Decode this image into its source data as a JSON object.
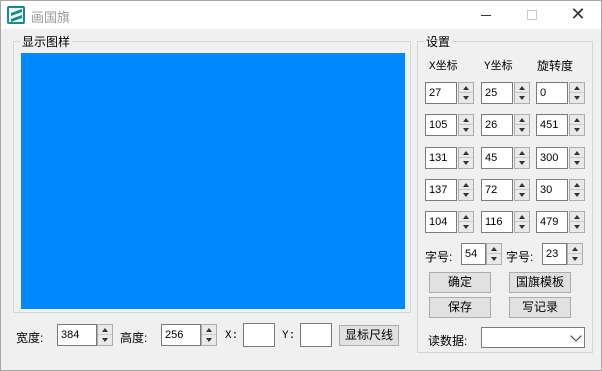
{
  "window": {
    "title": "画国旗"
  },
  "preview": {
    "group_title": "显示图样",
    "flag_color": "#0088ff"
  },
  "settings": {
    "group_title": "设置",
    "col_x": "X坐标",
    "col_y": "Y坐标",
    "col_rot": "旋转度",
    "rows": [
      {
        "x": "27",
        "y": "25",
        "rot": "0"
      },
      {
        "x": "105",
        "y": "26",
        "rot": "451"
      },
      {
        "x": "131",
        "y": "45",
        "rot": "300"
      },
      {
        "x": "137",
        "y": "72",
        "rot": "30"
      },
      {
        "x": "104",
        "y": "116",
        "rot": "479"
      }
    ],
    "font_size_label_1": "字号:",
    "font_size_value_1": "54",
    "font_size_label_2": "字号:",
    "font_size_value_2": "23",
    "confirm_label": "确定",
    "template_label": "国旗模板",
    "save_label": "保存",
    "write_record_label": "写记录",
    "read_data_label": "读数据:",
    "read_data_value": ""
  },
  "bottom": {
    "width_label": "宽度:",
    "width_value": "384",
    "height_label": "高度:",
    "height_value": "256",
    "x_label": "X:",
    "x_value": "",
    "y_label": "Y:",
    "y_value": "",
    "ruler_button_label": "显标尺线"
  },
  "colors": {
    "flag_blue": "#0088ff",
    "window_bg": "#f0f0f0"
  },
  "icons": {
    "app": "flag-app-icon",
    "minimize": "minimize-icon",
    "maximize": "maximize-icon",
    "close": "close-icon"
  }
}
